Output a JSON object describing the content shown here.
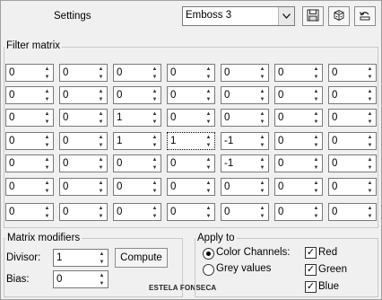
{
  "dialog": {
    "title": "Settings"
  },
  "preset": {
    "value": "Emboss 3"
  },
  "toolbar": {
    "save_icon": "floppy-disk-icon",
    "random_icon": "dice-icon",
    "reset_icon": "undo-icon"
  },
  "filter_matrix": {
    "label": "Filter matrix",
    "rows": [
      [
        "0",
        "0",
        "0",
        "0",
        "0",
        "0",
        "0"
      ],
      [
        "0",
        "0",
        "0",
        "0",
        "0",
        "0",
        "0"
      ],
      [
        "0",
        "0",
        "1",
        "0",
        "0",
        "0",
        "0"
      ],
      [
        "0",
        "0",
        "1",
        "1",
        "-1",
        "0",
        "0"
      ],
      [
        "0",
        "0",
        "0",
        "0",
        "-1",
        "0",
        "0"
      ],
      [
        "0",
        "0",
        "0",
        "0",
        "0",
        "0",
        "0"
      ],
      [
        "0",
        "0",
        "0",
        "0",
        "0",
        "0",
        "0"
      ]
    ]
  },
  "matrix_modifiers": {
    "label": "Matrix modifiers",
    "divisor_label": "Divisor:",
    "divisor_value": "1",
    "bias_label": "Bias:",
    "bias_value": "0",
    "compute_label": "Compute"
  },
  "apply_to": {
    "label": "Apply to",
    "color_channels_label": "Color Channels:",
    "grey_values_label": "Grey values",
    "red_label": "Red",
    "green_label": "Green",
    "blue_label": "Blue"
  },
  "watermark": "ESTELA FONSECA"
}
